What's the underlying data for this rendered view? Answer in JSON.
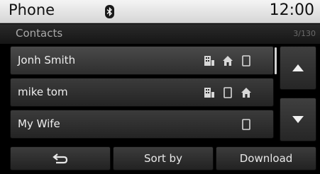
{
  "status": {
    "app_title": "Phone",
    "clock": "12:00",
    "bluetooth_icon": "bluetooth-icon"
  },
  "header": {
    "section_title": "Contacts",
    "page_counter": "3/130"
  },
  "contacts": [
    {
      "name": "Jonh Smith",
      "icons": [
        "office-icon",
        "home-icon",
        "mobile-icon"
      ],
      "selected": true
    },
    {
      "name": "mike tom",
      "icons": [
        "office-icon",
        "mobile-icon",
        "home-icon"
      ],
      "selected": false
    },
    {
      "name": "My Wife",
      "icons": [
        "mobile-icon"
      ],
      "selected": false
    }
  ],
  "scroll": {
    "up_icon": "arrow-up-icon",
    "down_icon": "arrow-down-icon"
  },
  "bottom_bar": {
    "back_icon": "back-arrow-icon",
    "sort_label": "Sort by",
    "download_label": "Download"
  },
  "colors": {
    "status_bar": "#e8e8e8",
    "row_bg": "#303030",
    "text": "#eeeeee",
    "icon": "#d8d8d8"
  }
}
